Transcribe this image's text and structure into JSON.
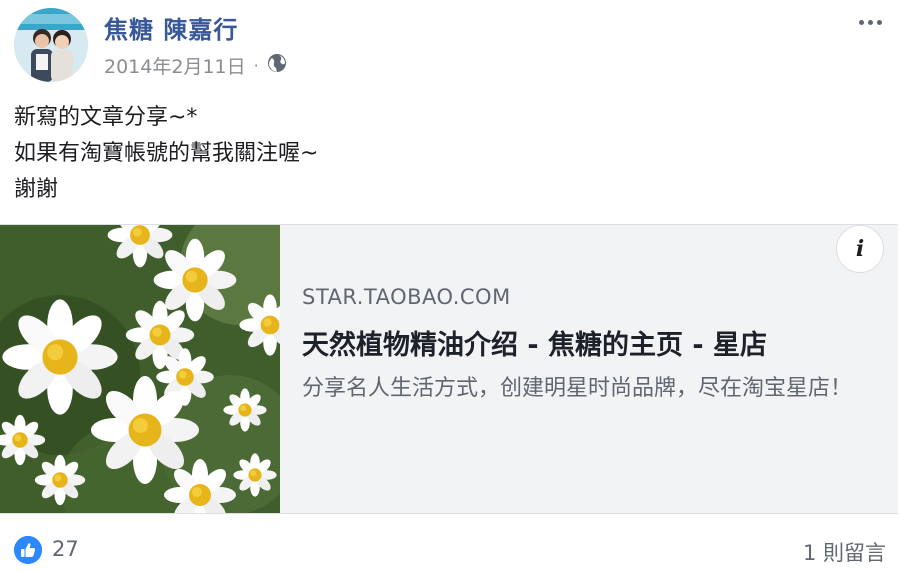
{
  "post": {
    "author": "焦糖 陳嘉行",
    "date": "2014年2月11日",
    "separator": "·",
    "privacy_icon": "globe-icon",
    "more_icon": "more-dots-icon",
    "body_lines": [
      "新寫的文章分享~*",
      "如果有淘寶帳號的幫我關注喔~",
      "謝謝"
    ]
  },
  "link_preview": {
    "domain": "STAR.TAOBAO.COM",
    "title": "天然植物精油介绍 - 焦糖的主页 - 星店",
    "description": "分享名人生活方式，创建明星时尚品牌，尽在淘宝星店！",
    "info_icon_label": "i",
    "thumbnail": "chamomile-flowers-photo"
  },
  "footer": {
    "reaction_icon": "like-icon",
    "like_count": "27",
    "comment_count": "1 則留言"
  },
  "colors": {
    "author": "#385898",
    "like_badge": "#2d88ff",
    "link_bg": "#f2f3f5"
  }
}
